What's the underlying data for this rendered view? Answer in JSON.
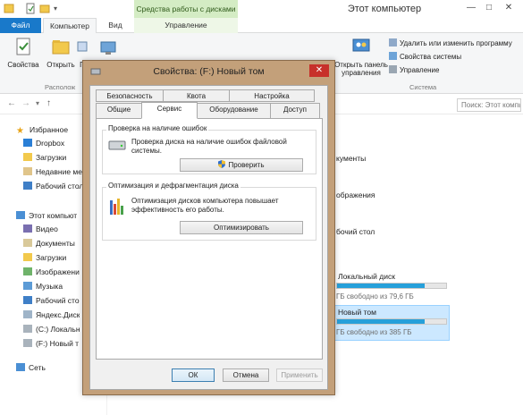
{
  "window": {
    "title": "Этот компьютер",
    "context_header": "Средства работы с дисками",
    "controls": [
      "—",
      "□",
      "✕"
    ]
  },
  "ribbon_tabs": {
    "file": "Файл",
    "computer": "Компьютер",
    "view": "Вид",
    "manage": "Управление"
  },
  "ribbon": {
    "properties": "Свойства",
    "open": "Открыть",
    "rename_partial": "П",
    "location_group": "Располож",
    "open_control_panel_line1": "Открыть панель",
    "open_control_panel_line2": "управления",
    "uninstall": "Удалить или изменить программу",
    "system_properties": "Свойства системы",
    "manage": "Управление",
    "system_group": "Система"
  },
  "search": {
    "placeholder": "Поиск: Этот компь"
  },
  "nav": {
    "favorites": "Избранное",
    "dropbox": "Dropbox",
    "downloads": "Загрузки",
    "recent": "Недавние ме",
    "desktop": "Рабочий стол",
    "this_pc": "Этот компьют",
    "video": "Видео",
    "documents": "Документы",
    "downloads2": "Загрузки",
    "images": "Изображени",
    "music": "Музыка",
    "desktop2": "Рабочий сто",
    "yandex": "Яндекс.Диск",
    "drive_c": "(C:) Локальн",
    "drive_f": "(F:) Новый т",
    "network": "Сеть"
  },
  "content": {
    "documents": "кументы",
    "images": "ображения",
    "desktop": "бочий стол",
    "local_disk": "Локальный диск",
    "local_disk_free": "ГБ свободно из 79,6 ГБ",
    "local_disk_used": 0.8,
    "new_volume": "Новый том",
    "new_volume_free": "ГБ свободно из 385 ГБ",
    "new_volume_used": 0.8
  },
  "dialog": {
    "title": "Свойства: (F:) Новый том",
    "close": "✕",
    "tabs_back": [
      "Безопасность",
      "Квота",
      "Настройка"
    ],
    "tabs_front": [
      "Общие",
      "Сервис",
      "Оборудование",
      "Доступ"
    ],
    "error_check": {
      "legend": "Проверка на наличие ошибок",
      "text_line1": "Проверка диска на наличие ошибок файловой",
      "text_line2": "системы.",
      "button": "Проверить"
    },
    "optimize": {
      "legend": "Оптимизация и дефрагментация диска",
      "text_line1": "Оптимизация дисков компьютера повышает",
      "text_line2": "эффективность его работы.",
      "button": "Оптимизировать"
    },
    "ok": "ОК",
    "cancel": "Отмена",
    "apply": "Применить"
  }
}
